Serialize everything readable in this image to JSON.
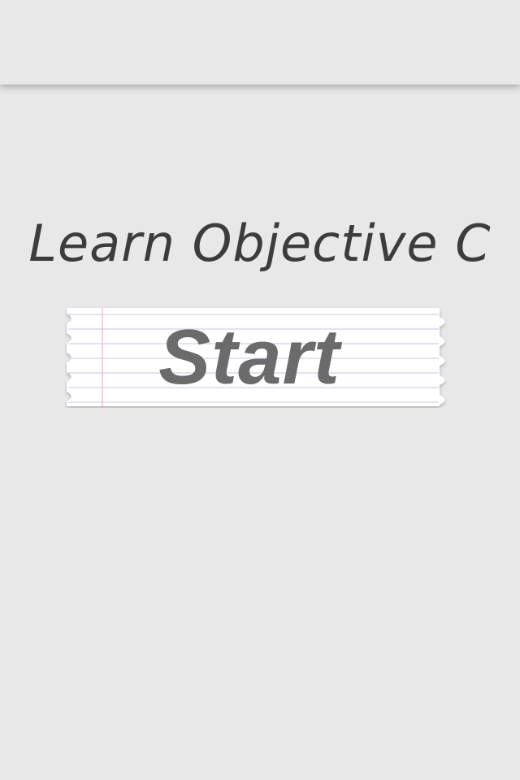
{
  "app": {
    "title": "Learn Objective C",
    "start_label": "Start"
  },
  "colors": {
    "background": "#e8e8e8",
    "title_text": "#3c3c3c",
    "button_text": "#6b6b6b",
    "paper": "#ffffff",
    "paper_lines": "#d6dbee",
    "paper_margin": "#f2b8c8"
  },
  "icons": {
    "button_background": "lined-paper-icon"
  }
}
